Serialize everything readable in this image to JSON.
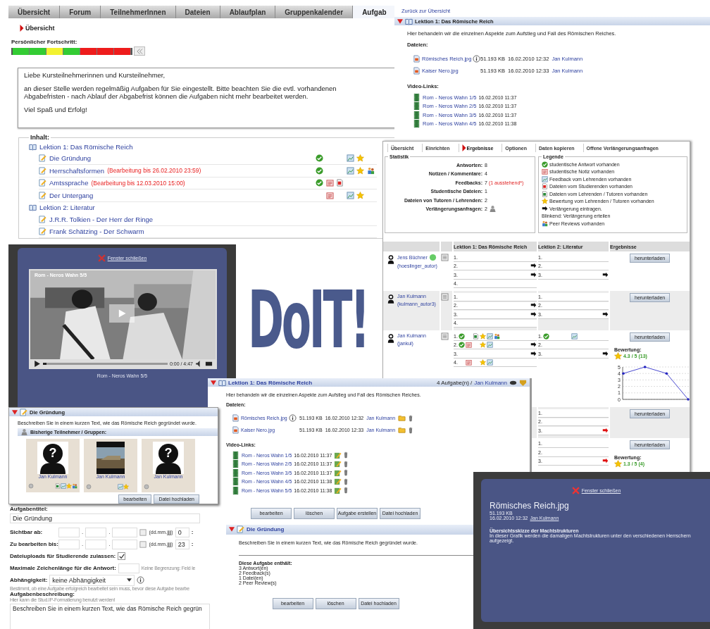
{
  "main": {
    "tabs": [
      {
        "label": "Übersicht",
        "selected": false
      },
      {
        "label": "Forum",
        "selected": false
      },
      {
        "label": "TeilnehmerInnen",
        "selected": false
      },
      {
        "label": "Dateien",
        "selected": false
      },
      {
        "label": "Ablaufplan",
        "selected": false
      },
      {
        "label": "Gruppenkalender",
        "selected": false
      },
      {
        "label": "Aufgab",
        "selected": true
      }
    ],
    "breadcrumb": "Übersicht",
    "progress": {
      "label": "Persönlicher Fortschritt:",
      "segments": [
        {
          "color": "#33cc33"
        },
        {
          "color": "#33cc33"
        },
        {
          "color": "#f2f230"
        },
        {
          "color": "#33cc33"
        },
        {
          "color": "#ee1c1c"
        },
        {
          "color": "#ee1c1c"
        },
        {
          "color": "#ee1c1c"
        }
      ]
    },
    "welcome": [
      "Liebe Kursteilnehmerinnen und Kursteilnehmer,",
      "an dieser Stelle werden regelmäßig Aufgaben für Sie eingestellt. Bitte beachten Sie die evtl. vorhandenen Abgabefristen - nach Ablauf der Abgabefrist können die Aufgaben nicht mehr bearbeitet werden.",
      "Viel Spaß und Erfolg!"
    ],
    "content_label": "Inhalt:",
    "lessons": [
      {
        "title": "Lektion 1: Das Römische Reich",
        "children": [
          {
            "title": "Die Gründung",
            "answer": true,
            "note": false,
            "student_file": false,
            "feedback": true,
            "rating": true,
            "peer_review": false
          },
          {
            "title": "Herrschaftsformen",
            "deadline": "(Bearbeitung bis 26.02.2010 23:59)",
            "answer": true,
            "note": false,
            "student_file": false,
            "feedback": true,
            "rating": true,
            "peer_review": true
          },
          {
            "title": "Amtssprache",
            "deadline": "(Bearbeitung bis 12.03.2010 15:00)",
            "answer": true,
            "note": true,
            "student_file": true,
            "feedback": false,
            "rating": false,
            "peer_review": false
          },
          {
            "title": "Der Untergang",
            "answer": false,
            "note": true,
            "student_file": false,
            "feedback": true,
            "rating": true,
            "peer_review": false
          }
        ]
      },
      {
        "title": "Lektion 2: Literatur",
        "children": [
          {
            "title": "J.R.R. Tolkien - Der Herr der Ringe",
            "answer": false,
            "note": false,
            "student_file": false,
            "feedback": false,
            "rating": false,
            "peer_review": false
          },
          {
            "title": "Frank Schätzing - Der Schwarm",
            "answer": false,
            "note": false,
            "student_file": false,
            "feedback": false,
            "rating": false,
            "peer_review": false
          }
        ]
      }
    ]
  },
  "lesson_overview": {
    "back_link": "Zurück zur Übersicht",
    "title": "Lektion 1: Das Römische Reich",
    "description": "Hier behandeln wir die einzelnen Aspekte zum Aufstieg und Fall des Römischen Reiches.",
    "files_label": "Dateien:",
    "files": [
      {
        "name": "Römisches Reich.jpg",
        "info": true,
        "size": "51.193 KB",
        "date": "16.02.2010 12:32",
        "author": "Jan Kulmann"
      },
      {
        "name": "Kaiser Nero.jpg",
        "info": false,
        "size": "51.193 KB",
        "date": "16.02.2010 12:33",
        "author": "Jan Kulmann"
      }
    ],
    "videos_label": "Video-Links:",
    "videos": [
      {
        "title": "Rom - Neros Wahn 1/5",
        "date": "16.02.2010 11:37"
      },
      {
        "title": "Rom - Neros Wahn 2/5",
        "date": "16.02.2010 11:37"
      },
      {
        "title": "Rom - Neros Wahn 3/5",
        "date": "16.02.2010 11:37"
      },
      {
        "title": "Rom - Neros Wahn 4/5",
        "date": "16.02.2010 11:38"
      }
    ]
  },
  "results": {
    "tabs": [
      {
        "label": "Übersicht",
        "selected": false
      },
      {
        "label": "Einrichten",
        "selected": false
      },
      {
        "label": "Ergebnisse",
        "selected": true
      },
      {
        "label": "Optionen",
        "selected": false
      },
      {
        "label": "Daten kopieren",
        "selected": false
      },
      {
        "label": "Offene Verlängerungsanfragen",
        "selected": false
      }
    ],
    "statistics": {
      "title": "Statistik",
      "rows": [
        {
          "label": "Antworten:",
          "value": "8"
        },
        {
          "label": "Notizen / Kommentare:",
          "value": "4"
        },
        {
          "label": "Feedbacks:",
          "value": "7",
          "note": "(1 ausstehend*)"
        },
        {
          "label": "Studentische Dateien:",
          "value": "1"
        },
        {
          "label": "Dateien von Tutoren / Lehrenden:",
          "value": "2"
        },
        {
          "label": "Verlängerungsanfragen:",
          "value": "2",
          "requests": true
        }
      ]
    },
    "legend": {
      "title": "Legende",
      "items": [
        {
          "kind": "answer",
          "text": "studentische Antwort vorhanden"
        },
        {
          "kind": "note",
          "text": "studentische Notiz vorhanden"
        },
        {
          "kind": "feedback",
          "text": "Feedback vom Lehrenden vorhanden"
        },
        {
          "kind": "student_file",
          "text": "Dateien vom Studierenden vorhanden"
        },
        {
          "kind": "tutor_file",
          "text": "Dateien vom Lehrenden / Tutoren vorhanden"
        },
        {
          "kind": "rating",
          "text": "Bewertung vom Lehrenden / Tutoren vorhanden"
        },
        {
          "kind": "extension",
          "text": "Verlängerung eintragen."
        },
        {
          "kind": "plain",
          "text": "Blinkend: Verlängerung erteilen"
        },
        {
          "kind": "peer_review",
          "text": "Peer Reviews vorhanden"
        }
      ]
    },
    "columns": [
      "Lektion 1: Das Römische Reich",
      "Lektion 2: Literatur",
      "Ergebnisse"
    ],
    "rows": [
      {
        "name": "Jens Büchner",
        "login": "(hoeslinger_autor)",
        "online": true,
        "button": "herunterladen",
        "lesson1": [
          {
            "number": "1.",
            "answer": false,
            "note": false,
            "tutor_file": false,
            "rating": false,
            "feedback": false,
            "peer_review": false,
            "extension": false,
            "extension_requested": false
          },
          {
            "number": "2.",
            "answer": false,
            "note": false,
            "tutor_file": false,
            "rating": false,
            "feedback": false,
            "peer_review": false,
            "extension": true,
            "extension_requested": false
          },
          {
            "number": "3.",
            "answer": false,
            "note": false,
            "tutor_file": false,
            "rating": false,
            "feedback": false,
            "peer_review": false,
            "extension": true,
            "extension_requested": false
          },
          {
            "number": "4.",
            "answer": false,
            "note": false,
            "tutor_file": false,
            "rating": false,
            "feedback": false,
            "peer_review": false,
            "extension": false,
            "extension_requested": false
          }
        ],
        "lesson2": [
          {
            "number": "1.",
            "answer": false,
            "note": false,
            "tutor_file": false,
            "rating": false,
            "feedback": false,
            "peer_review": false,
            "extension": false,
            "extension_requested": false
          },
          {
            "number": "2.",
            "answer": false,
            "note": false,
            "tutor_file": false,
            "rating": false,
            "feedback": false,
            "peer_review": false,
            "extension": false,
            "extension_requested": false
          },
          {
            "number": "3.",
            "answer": false,
            "note": false,
            "tutor_file": false,
            "rating": false,
            "feedback": false,
            "peer_review": false,
            "extension": true,
            "extension_requested": false
          }
        ]
      },
      {
        "name": "Jan Kulmann",
        "login": "(kulmann_autor3)",
        "online": false,
        "button": "herunterladen",
        "lesson1": [
          {
            "number": "1.",
            "answer": false,
            "note": false,
            "tutor_file": false,
            "rating": false,
            "feedback": false,
            "peer_review": false,
            "extension": false,
            "extension_requested": false
          },
          {
            "number": "2.",
            "answer": false,
            "note": false,
            "tutor_file": false,
            "rating": false,
            "feedback": false,
            "peer_review": false,
            "extension": true,
            "extension_requested": false
          },
          {
            "number": "3.",
            "answer": false,
            "note": false,
            "tutor_file": false,
            "rating": false,
            "feedback": false,
            "peer_review": false,
            "extension": true,
            "extension_requested": false
          },
          {
            "number": "4.",
            "answer": false,
            "note": false,
            "tutor_file": false,
            "rating": false,
            "feedback": false,
            "peer_review": false,
            "extension": false,
            "extension_requested": false
          }
        ],
        "lesson2": [
          {
            "number": "1.",
            "answer": false,
            "note": false,
            "tutor_file": false,
            "rating": false,
            "feedback": false,
            "peer_review": false,
            "extension": false,
            "extension_requested": false
          },
          {
            "number": "2.",
            "answer": false,
            "note": false,
            "tutor_file": false,
            "rating": false,
            "feedback": false,
            "peer_review": false,
            "extension": false,
            "extension_requested": false
          },
          {
            "number": "3.",
            "answer": false,
            "note": false,
            "tutor_file": false,
            "rating": false,
            "feedback": false,
            "peer_review": false,
            "extension": true,
            "extension_requested": false
          }
        ]
      },
      {
        "name": "Jan Kulmann",
        "login": "(jankul)",
        "online": false,
        "button": "herunterladen",
        "rating_label": "Bewertung:",
        "score": "4.3 / 5 (13)",
        "chart_data": {
          "type": "line",
          "values": [
            4,
            5,
            4,
            0
          ],
          "ylim": [
            0,
            5
          ],
          "yticks": [
            0,
            1,
            2,
            3,
            4,
            5
          ],
          "grid": true
        },
        "lesson1": [
          {
            "number": "1.",
            "answer": true,
            "note": false,
            "tutor_file": true,
            "rating": true,
            "feedback": true,
            "peer_review": true,
            "extension": false,
            "extension_requested": false
          },
          {
            "number": "2.",
            "answer": true,
            "note": true,
            "tutor_file": false,
            "rating": true,
            "feedback": true,
            "peer_review": false,
            "extension": true,
            "extension_requested": false
          },
          {
            "number": "3.",
            "answer": false,
            "note": false,
            "tutor_file": false,
            "rating": false,
            "feedback": false,
            "peer_review": false,
            "extension": true,
            "extension_requested": false
          },
          {
            "number": "4.",
            "answer": false,
            "note": true,
            "tutor_file": false,
            "rating": true,
            "feedback": true,
            "peer_review": false,
            "extension": false,
            "extension_requested": false
          }
        ],
        "lesson2": [
          {
            "number": "1.",
            "answer": true,
            "note": false,
            "tutor_file": false,
            "rating": false,
            "feedback": true,
            "peer_review": false,
            "extension": false,
            "extension_requested": false
          },
          {
            "number": "2.",
            "answer": false,
            "note": false,
            "tutor_file": false,
            "rating": false,
            "feedback": false,
            "peer_review": false,
            "extension": false,
            "extension_requested": false
          },
          {
            "number": "3.",
            "answer": false,
            "note": false,
            "tutor_file": false,
            "rating": false,
            "feedback": false,
            "peer_review": false,
            "extension": true,
            "extension_requested": false
          }
        ]
      },
      {
        "button": "herunterladen",
        "lesson2": [
          {
            "number": "1.",
            "answer": false,
            "note": false,
            "tutor_file": false,
            "rating": false,
            "feedback": false,
            "peer_review": false,
            "extension": false,
            "extension_requested": false
          },
          {
            "number": "2.",
            "answer": false,
            "note": false,
            "tutor_file": false,
            "rating": false,
            "feedback": false,
            "peer_review": false,
            "extension": false,
            "extension_requested": false
          },
          {
            "number": "3.",
            "answer": false,
            "note": false,
            "tutor_file": false,
            "rating": false,
            "feedback": false,
            "peer_review": false,
            "extension": false,
            "extension_requested": true
          }
        ]
      },
      {
        "button": "herunterladen",
        "rating_label": "Bewertung:",
        "score": "1.3 / 5 (4)",
        "lesson2": [
          {
            "number": "1.",
            "answer": false,
            "note": false,
            "tutor_file": false,
            "rating": false,
            "feedback": false,
            "peer_review": false,
            "extension": false,
            "extension_requested": false
          },
          {
            "number": "2.",
            "answer": false,
            "note": false,
            "tutor_file": false,
            "rating": false,
            "feedback": false,
            "peer_review": false,
            "extension": false,
            "extension_requested": false
          },
          {
            "number": "3.",
            "answer": false,
            "note": false,
            "tutor_file": false,
            "rating": false,
            "feedback": false,
            "peer_review": false,
            "extension": false,
            "extension_requested": true
          }
        ]
      }
    ]
  },
  "video_window": {
    "close_link": "Fenster schließen",
    "video_title": "Rom - Neros Wahn 5/5",
    "time": "0:00 / 4:47",
    "level": 0.03,
    "caption": "Rom - Neros Wahn 5/5"
  },
  "logo": "DoIT!",
  "task_card": {
    "title": "Die Gründung",
    "description": "Beschreiben Sie in einem kurzen Text, wie das Römische Reich gegründet wurde.",
    "participants_label": "Bisherige Teilnehmer / Gruppen:",
    "participants": [
      {
        "name": "Jan Kulmann",
        "photo": false,
        "avatar_text": "?",
        "answer": true,
        "tutor_file": true,
        "feedback": true,
        "rating": true,
        "peer_review": true
      },
      {
        "name": "Jan Kulmann",
        "photo": true,
        "answer": true,
        "tutor_file": false,
        "feedback": true,
        "rating": true,
        "peer_review": false
      },
      {
        "name": "Jan Kulmann",
        "photo": false,
        "avatar_text": "?",
        "answer": true,
        "tutor_file": false,
        "feedback": false,
        "rating": false,
        "peer_review": false
      }
    ],
    "buttons": [
      "bearbeiten",
      "Datei hochladen"
    ]
  },
  "task_form": {
    "title_label": "Aufgabentitel:",
    "title_value": "Die Gründung",
    "dates": [
      {
        "label": "Sichtbar ab:",
        "separators": [
          ".",
          "."
        ],
        "hint": "(dd.mm.jjjj)",
        "hour": "0",
        "time_separator": ":"
      },
      {
        "label": "Zu bearbeiten bis:",
        "separators": [
          ".",
          "."
        ],
        "hint": "(dd.mm.jjjj)",
        "hour": "23",
        "time_separator": ":"
      }
    ],
    "uploads_label": "Dateiuploads für Studierende zulassen:",
    "uploads_checked": true,
    "maxlen_label": "Maximale Zeichenlänge für die Antwort:",
    "maxlen_hint": "Keine Begrenzung: Feld le",
    "dependency_label": "Abhängigkeit:",
    "dependency_value": "keine Abhängigkeit",
    "dependency_help": "Bestimmt, ob eine Aufgabe erfolgreich bearbeitet sein muss, bevor diese Aufgabe bearbe",
    "description_label": "Aufgabenbeschreibung:",
    "description_help": "Hier kann die Stud.IP-Formatierung benutzt werden!",
    "description_value": "Beschreiben Sie in einem kurzen Text, wie das Römische Reich gegrün"
  },
  "lesson_panel": {
    "title": "Lektion 1: Das Römische Reich",
    "task_count": "4 Aufgabe(n) /",
    "author": "Jan Kulmann",
    "description": "Hier behandeln wir die einzelnen Aspekte zum Aufstieg und Fall des Römischen Reiches.",
    "files_label": "Dateien:",
    "files": [
      {
        "name": "Römisches Reich.jpg",
        "info": true,
        "size": "51.193 KB",
        "date": "16.02.2010 12:32",
        "author": "Jan Kulmann"
      },
      {
        "name": "Kaiser Nero.jpg",
        "info": false,
        "size": "51.193 KB",
        "date": "16.02.2010 12:33",
        "author": "Jan Kulmann"
      }
    ],
    "videos_label": "Video-Links:",
    "videos": [
      {
        "title": "Rom - Neros Wahn 1/5",
        "date": "16.02.2010 11:37"
      },
      {
        "title": "Rom - Neros Wahn 2/5",
        "date": "16.02.2010 11:37"
      },
      {
        "title": "Rom - Neros Wahn 3/5",
        "date": "16.02.2010 11:37"
      },
      {
        "title": "Rom - Neros Wahn 4/5",
        "date": "16.02.2010 11:38"
      },
      {
        "title": "Rom - Neros Wahn 5/5",
        "date": "16.02.2010 11:38"
      }
    ],
    "buttons": [
      "bearbeiten",
      "löschen",
      "Aufgabe erstellen",
      "Datei hochladen"
    ],
    "task": {
      "title": "Die Gründung",
      "description": "Beschreiben Sie in einem kurzen Text, wie das Römische Reich gegründet wurde.",
      "contains_label": "Diese Aufgabe enthält:",
      "contains": [
        "3 Antwort(en)",
        "2 Feedback(s)",
        "1 Datei(en)",
        "2 Peer Review(s)"
      ],
      "buttons": [
        "bearbeiten",
        "löschen",
        "Datei hochladen"
      ]
    }
  },
  "file_popup": {
    "close_link": "Fenster schließen",
    "title": "Römisches Reich.jpg",
    "size": "51.193 KB",
    "date": "16.02.2010 12:32",
    "author": "Jan Kulmann",
    "description_title": "Übersichtsskizze der Machtstrukturen",
    "description": "In dieser Grafik werden die damaligen Machtstrukturen unter den verschiedenen Herrschern aufgezeigt."
  }
}
